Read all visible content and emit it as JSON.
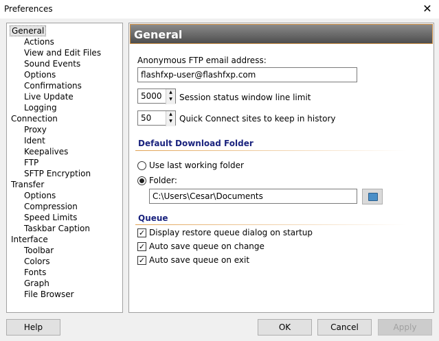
{
  "window": {
    "title": "Preferences",
    "close": "✕"
  },
  "tree": [
    {
      "label": "General",
      "level": 0,
      "selected": true
    },
    {
      "label": "Actions",
      "level": 1
    },
    {
      "label": "View and Edit Files",
      "level": 1
    },
    {
      "label": "Sound Events",
      "level": 1
    },
    {
      "label": "Options",
      "level": 1
    },
    {
      "label": "Confirmations",
      "level": 1
    },
    {
      "label": "Live Update",
      "level": 1
    },
    {
      "label": "Logging",
      "level": 1
    },
    {
      "label": "Connection",
      "level": 0
    },
    {
      "label": "Proxy",
      "level": 1
    },
    {
      "label": "Ident",
      "level": 1
    },
    {
      "label": "Keepalives",
      "level": 1
    },
    {
      "label": "FTP",
      "level": 1
    },
    {
      "label": "SFTP Encryption",
      "level": 1
    },
    {
      "label": "Transfer",
      "level": 0
    },
    {
      "label": "Options",
      "level": 1
    },
    {
      "label": "Compression",
      "level": 1
    },
    {
      "label": "Speed Limits",
      "level": 1
    },
    {
      "label": "Taskbar Caption",
      "level": 1
    },
    {
      "label": "Interface",
      "level": 0
    },
    {
      "label": "Toolbar",
      "level": 1
    },
    {
      "label": "Colors",
      "level": 1
    },
    {
      "label": "Fonts",
      "level": 1
    },
    {
      "label": "Graph",
      "level": 1
    },
    {
      "label": "File Browser",
      "level": 1
    }
  ],
  "panel": {
    "header": "General",
    "email_label": "Anonymous FTP email address:",
    "email_value": "flashfxp-user@flashfxp.com",
    "line_limit_value": "5000",
    "line_limit_label": "Session status window line limit",
    "quick_value": "50",
    "quick_label": "Quick Connect sites to keep in history",
    "download_section": "Default Download Folder",
    "use_last_label": "Use last working folder",
    "folder_label": "Folder:",
    "folder_value": "C:\\Users\\Cesar\\Documents",
    "queue_section": "Queue",
    "queue_opts": [
      "Display restore queue dialog on startup",
      "Auto save queue on change",
      "Auto save queue on exit"
    ]
  },
  "buttons": {
    "help": "Help",
    "ok": "OK",
    "cancel": "Cancel",
    "apply": "Apply"
  }
}
